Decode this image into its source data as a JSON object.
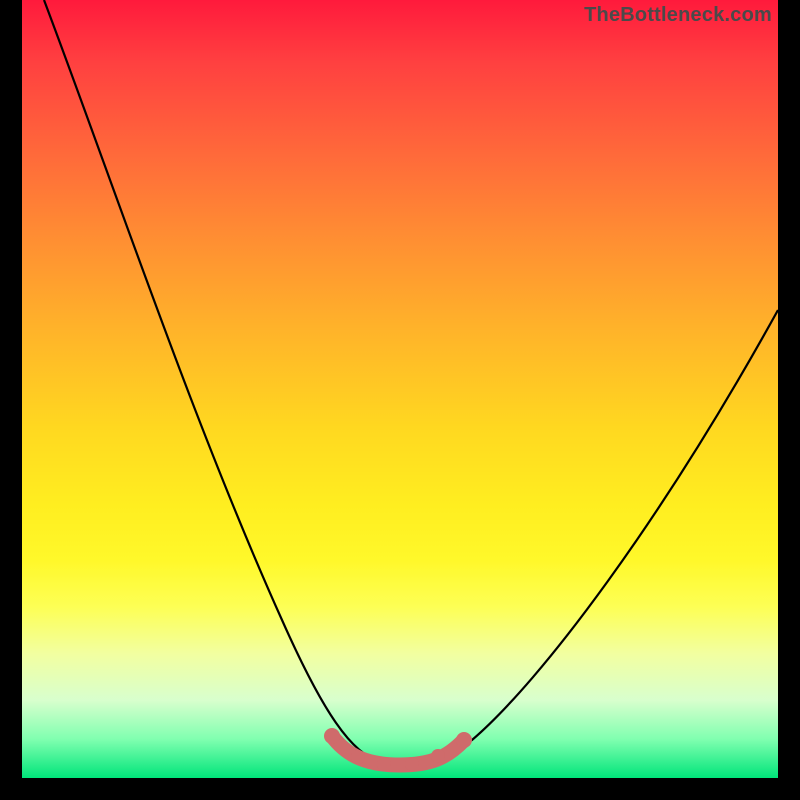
{
  "watermark": "TheBottleneck.com",
  "chart_data": {
    "type": "line",
    "title": "",
    "xlabel": "",
    "ylabel": "",
    "series": [
      {
        "name": "bottleneck-curve",
        "x": [
          0.03,
          0.1,
          0.17,
          0.24,
          0.31,
          0.35,
          0.38,
          0.41,
          0.44,
          0.47,
          0.5,
          0.53,
          0.56,
          0.6,
          0.66,
          0.74,
          0.83,
          0.92,
          1.0
        ],
        "y": [
          100,
          85,
          70,
          55,
          40,
          28,
          18,
          10,
          4,
          1,
          0,
          1,
          4,
          9,
          18,
          30,
          42,
          52,
          60
        ]
      },
      {
        "name": "highlight-band",
        "x": [
          0.41,
          0.44,
          0.47,
          0.5,
          0.53,
          0.56
        ],
        "y": [
          2,
          2,
          2,
          2,
          2,
          2
        ]
      }
    ],
    "xlim": [
      0,
      1
    ],
    "ylim": [
      0,
      100
    ],
    "colors": {
      "curve": "#000000",
      "highlight": "#cf6b6b",
      "gradient_top": "#ff1a3c",
      "gradient_bottom": "#00e57a"
    }
  }
}
